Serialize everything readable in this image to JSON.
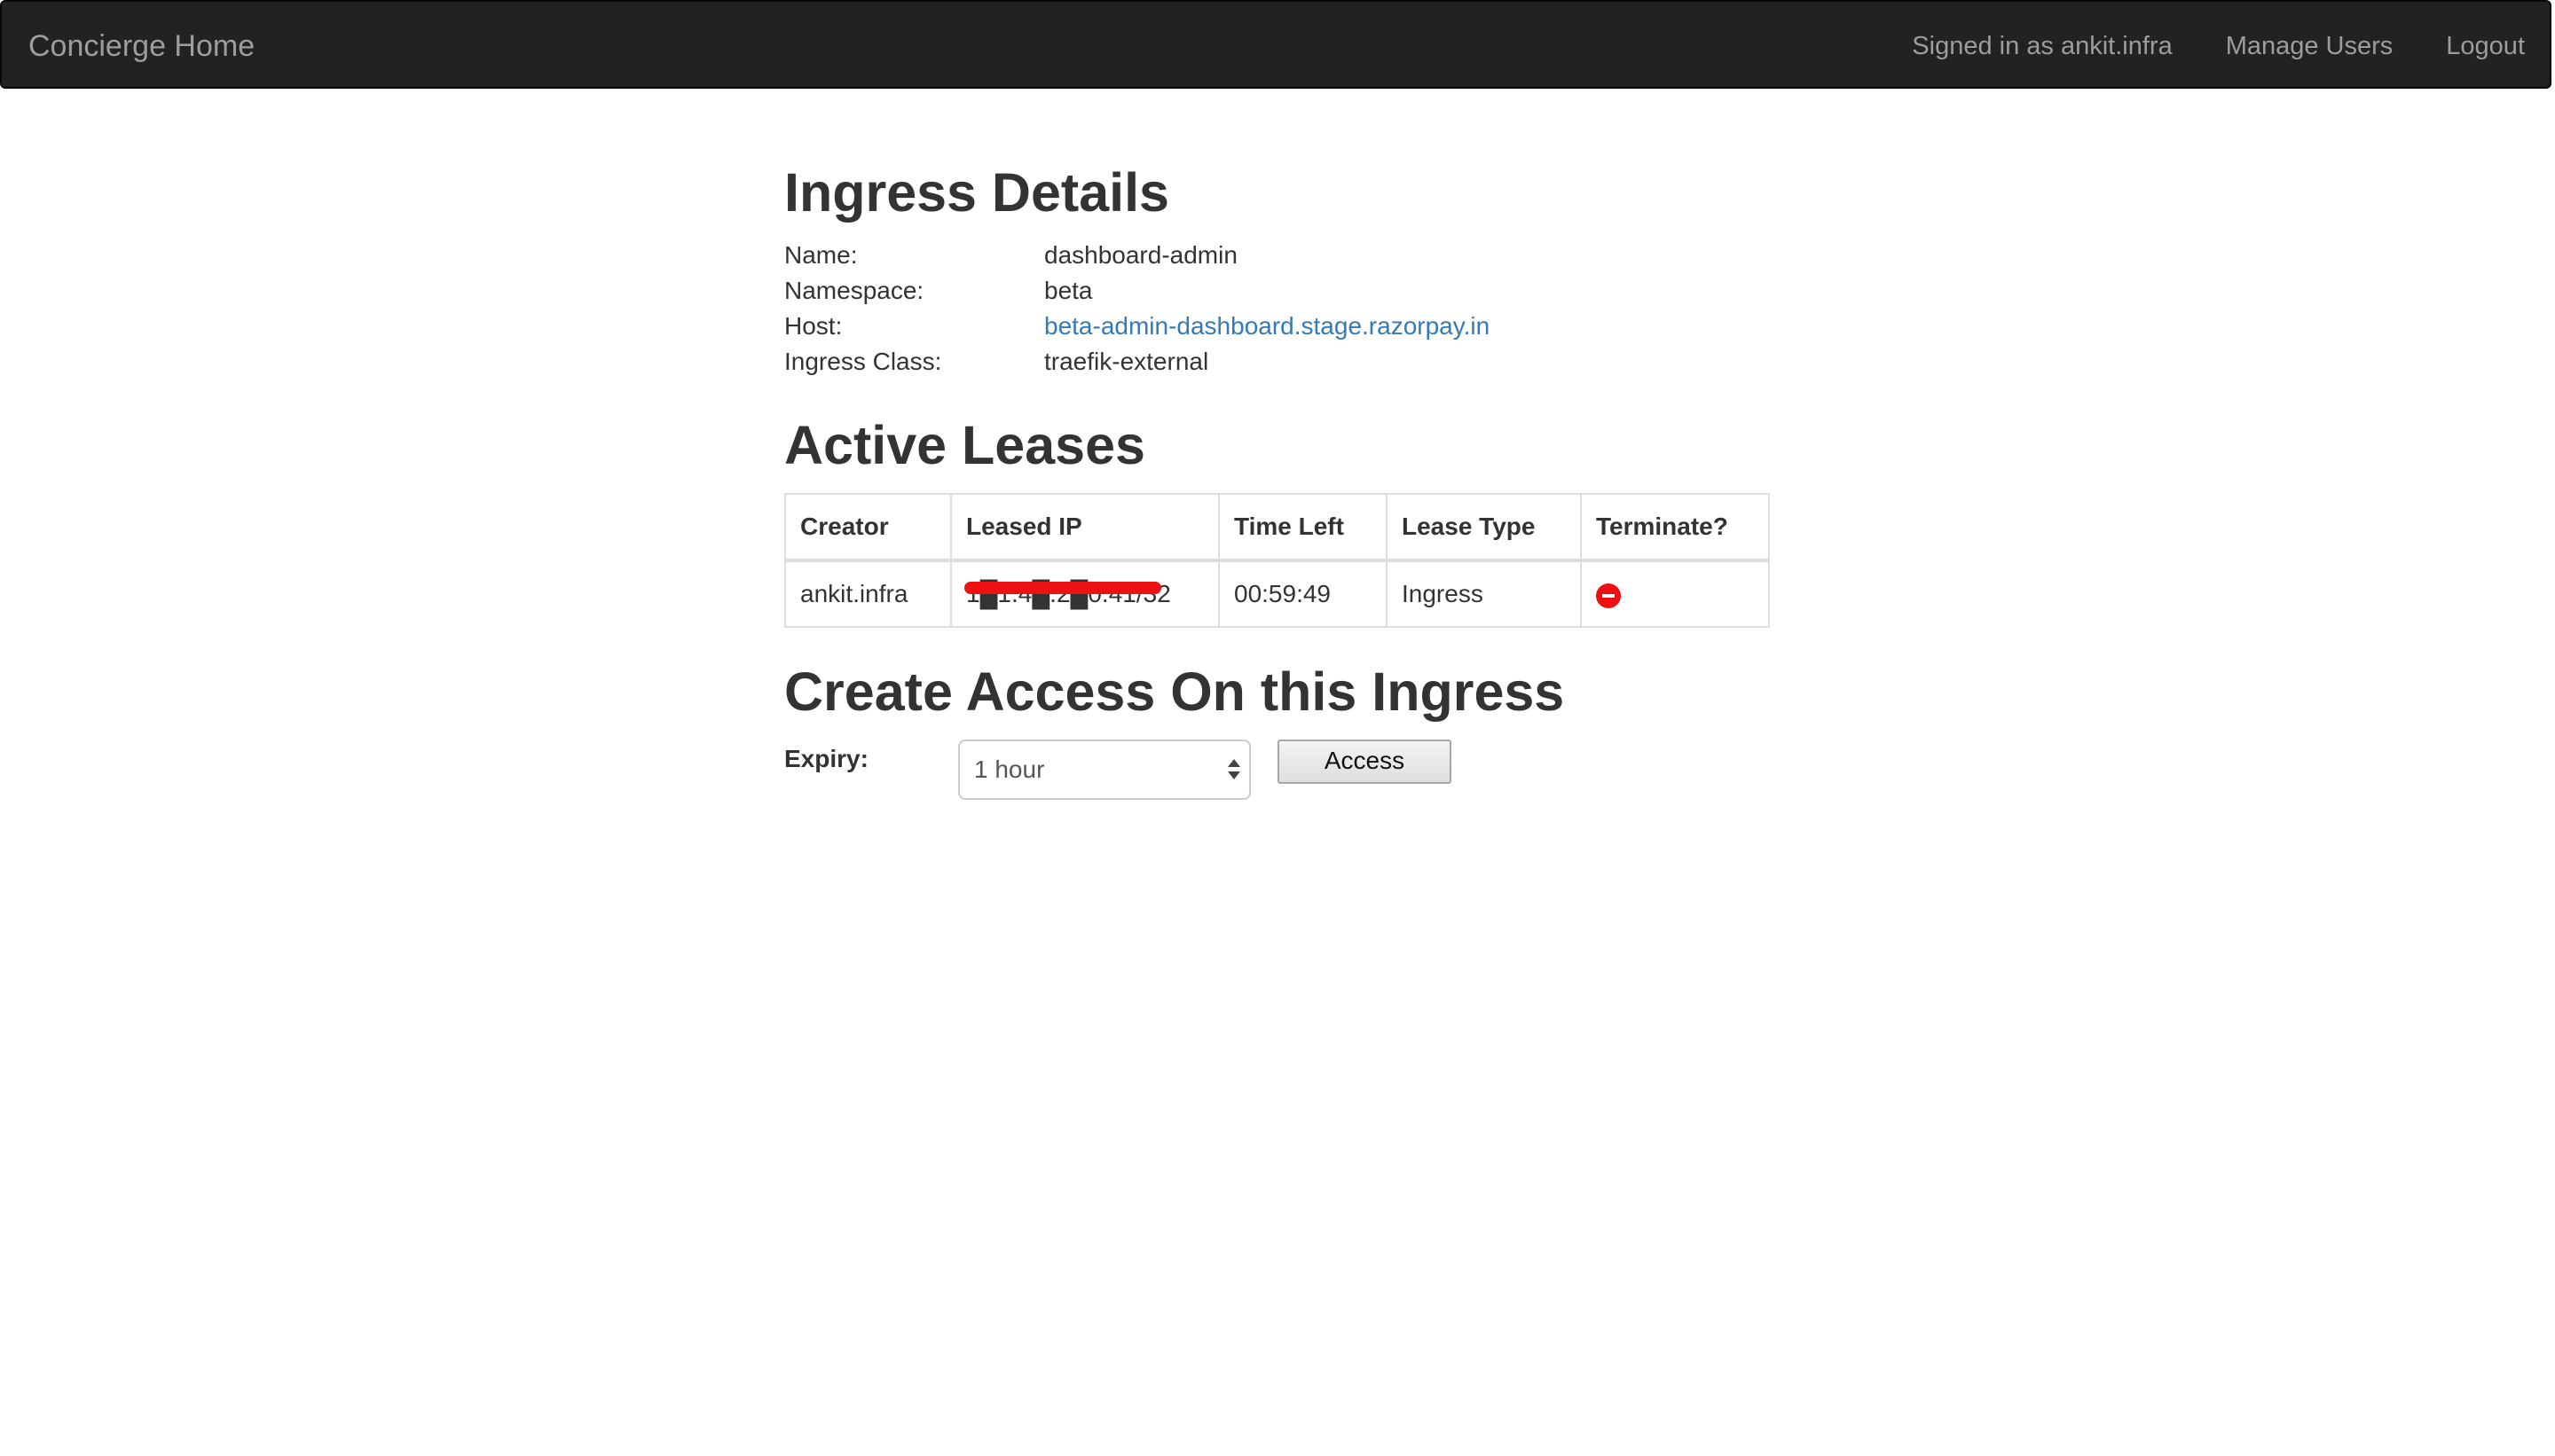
{
  "navbar": {
    "brand": "Concierge Home",
    "signed_in": "Signed in as ankit.infra",
    "manage_users": "Manage Users",
    "logout": "Logout"
  },
  "ingress_details": {
    "heading": "Ingress Details",
    "rows": [
      {
        "label": "Name:",
        "value": "dashboard-admin"
      },
      {
        "label": "Namespace:",
        "value": "beta"
      },
      {
        "label": "Host:",
        "value": "beta-admin-dashboard.stage.razorpay.in"
      },
      {
        "label": "Ingress Class:",
        "value": "traefik-external"
      }
    ]
  },
  "active_leases": {
    "heading": "Active Leases",
    "columns": [
      "Creator",
      "Leased IP",
      "Time Left",
      "Lease Type",
      "Terminate?"
    ],
    "rows": [
      {
        "creator": "ankit.infra",
        "leased_ip": "1█1.4█.2█0.41/32",
        "time_left": "00:59:49",
        "lease_type": "Ingress"
      }
    ]
  },
  "create_access": {
    "heading": "Create Access On this Ingress",
    "expiry_label": "Expiry:",
    "expiry_value": "1 hour",
    "button": "Access"
  },
  "colors": {
    "navbar_bg": "#222222",
    "navbar_text": "#9d9d9d",
    "link": "#337ab7",
    "terminate": "#ee1111",
    "redaction": "#ee1111"
  }
}
